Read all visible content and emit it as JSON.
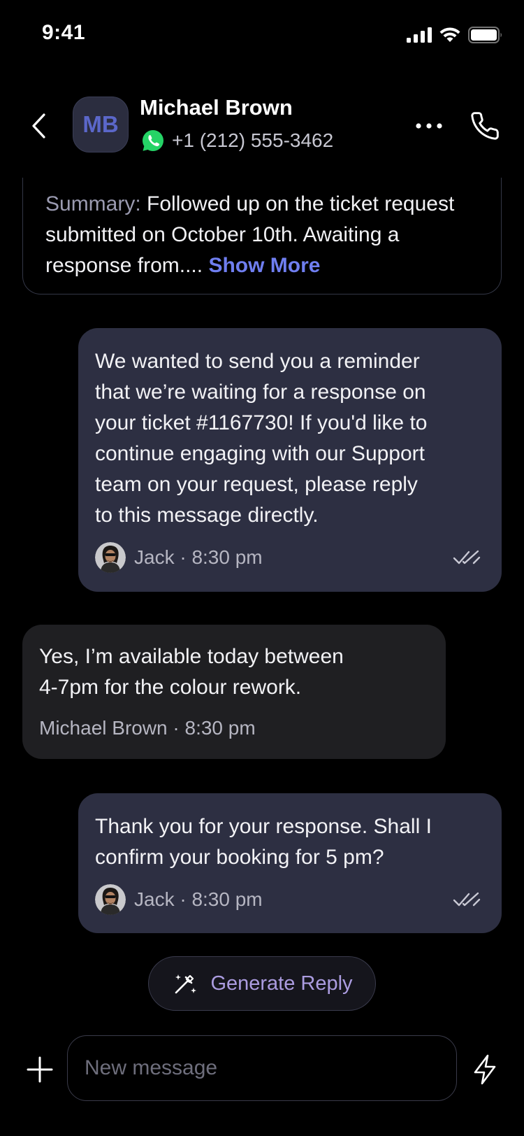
{
  "status_bar": {
    "time": "9:41",
    "icons": [
      "cellular-signal-icon",
      "wifi-icon",
      "battery-icon"
    ]
  },
  "header": {
    "back_icon": "chevron-left-icon",
    "avatar_initials": "MB",
    "contact_name": "Michael Brown",
    "channel_icon": "whatsapp-icon",
    "phone": "+1 (212) 555-3462",
    "more_icon": "ellipsis-icon",
    "call_icon": "phone-icon"
  },
  "summary": {
    "label": "Summary:",
    "text": " Followed up on the ticket request submitted on October 10th. Awaiting a response from.... ",
    "show_more": "Show More"
  },
  "messages": [
    {
      "direction": "outgoing",
      "text": "We wanted to send you a reminder\nthat we’re waiting for a response on\nyour ticket #1167730! If you'd like to\ncontinue engaging with our Support\nteam on your request, please reply\nto this message directly.",
      "meta": "Jack · 8:30 pm",
      "read_icon": "double-check-icon"
    },
    {
      "direction": "incoming",
      "text": "Yes, I’m available today between\n4-7pm for the colour rework.",
      "meta": "Michael Brown · 8:30 pm"
    },
    {
      "direction": "outgoing",
      "text": "Thank you for your response. Shall I\nconfirm your booking for 5 pm?",
      "meta": "Jack · 8:30 pm",
      "read_icon": "double-check-icon"
    }
  ],
  "generate_reply": {
    "icon": "magic-wand-icon",
    "label": "Generate Reply"
  },
  "composer": {
    "add_icon": "plus-icon",
    "placeholder": "New message",
    "value": "",
    "quick_icon": "lightning-icon"
  },
  "colors": {
    "background": "#000000",
    "outgoing_bubble": "#2d2f42",
    "incoming_bubble": "#1f1f22",
    "accent_link": "#6f7ef0",
    "generate_reply_text": "#ab9ce0",
    "whatsapp_green": "#25d366"
  }
}
